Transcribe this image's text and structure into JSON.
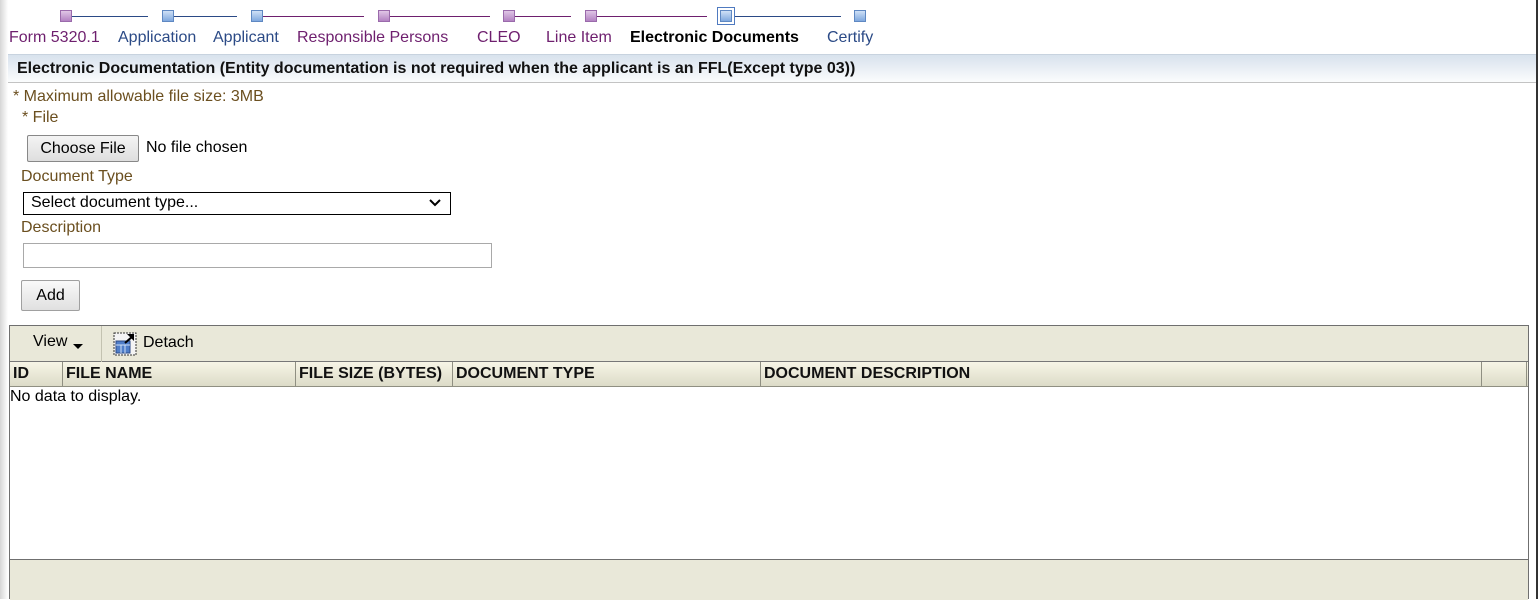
{
  "train": {
    "stops": [
      {
        "label": "Form 5320.1",
        "state": "visited"
      },
      {
        "label": "Application",
        "state": "unvisited"
      },
      {
        "label": "Applicant",
        "state": "unvisited"
      },
      {
        "label": "Responsible Persons",
        "state": "visited"
      },
      {
        "label": "CLEO",
        "state": "visited"
      },
      {
        "label": "Line Item",
        "state": "visited"
      },
      {
        "label": "Electronic Documents",
        "state": "current"
      },
      {
        "label": "Certify",
        "state": "unvisited"
      }
    ]
  },
  "section": {
    "title": "Electronic Documentation (Entity documentation is not required when the applicant is an FFL(Except type 03))"
  },
  "form": {
    "max_size_note": "* Maximum allowable file size: 3MB",
    "file_label": "* File",
    "choose_file_label": "Choose File",
    "no_file_text": "No file chosen",
    "doc_type_label": "Document Type",
    "doc_type_selected": "Select document type...",
    "description_label": "Description",
    "description_value": "",
    "add_label": "Add"
  },
  "table": {
    "toolbar": {
      "view_label": "View",
      "detach_label": "Detach"
    },
    "columns": [
      "ID",
      "FILE NAME",
      "FILE SIZE (BYTES)",
      "DOCUMENT TYPE",
      "DOCUMENT DESCRIPTION"
    ],
    "rows": [],
    "empty_message": "No data to display."
  },
  "colors": {
    "visited": "#6e1f6e",
    "unvisited": "#2b4a86",
    "label_brown": "#6b4f1f",
    "table_chrome": "#e9e8d9"
  }
}
